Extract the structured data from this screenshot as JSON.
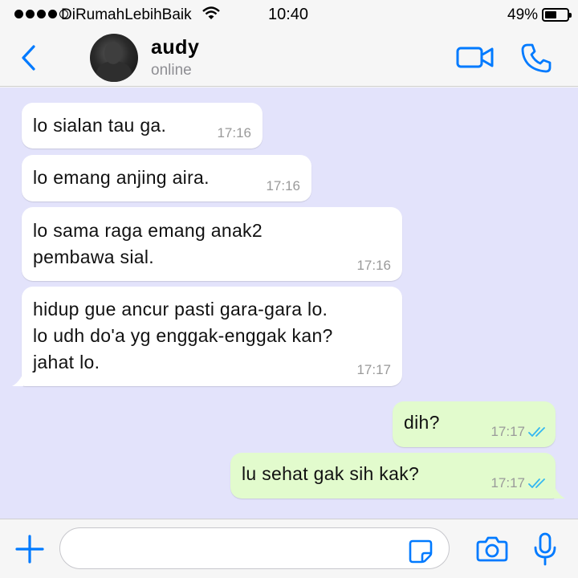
{
  "status_bar": {
    "carrier": "DiRumahLebihBaik",
    "time": "10:40",
    "battery_percent": "49%",
    "battery_level": 0.49,
    "signal_bars": 4
  },
  "header": {
    "back_icon": "chevron-left-icon",
    "contact_name": "audy",
    "contact_status": "online",
    "video_icon": "video-camera-icon",
    "call_icon": "phone-icon"
  },
  "colors": {
    "accent": "#007aff",
    "chat_background": "#e3e3fb",
    "incoming_bubble": "#ffffff",
    "outgoing_bubble": "#e2fbcd",
    "read_ticks": "#34b7f1"
  },
  "messages": [
    {
      "direction": "in",
      "text": "lo sialan tau ga.",
      "time": "17:16"
    },
    {
      "direction": "in",
      "text": "lo emang anjing aira.",
      "time": "17:16"
    },
    {
      "direction": "in",
      "text": "lo sama raga emang anak2\npembawa sial.",
      "time": "17:16"
    },
    {
      "direction": "in",
      "text": "hidup gue ancur pasti gara-gara lo.\nlo udh do'a yg enggak-enggak kan?\njahat lo.",
      "time": "17:17"
    },
    {
      "direction": "out",
      "text": "dih?",
      "time": "17:17",
      "status": "read"
    },
    {
      "direction": "out",
      "text": "lu sehat gak sih kak?",
      "time": "17:17",
      "status": "read"
    }
  ],
  "input_bar": {
    "plus_icon": "plus-icon",
    "message_value": "",
    "sticker_icon": "sticker-icon",
    "camera_icon": "camera-icon",
    "mic_icon": "microphone-icon"
  }
}
